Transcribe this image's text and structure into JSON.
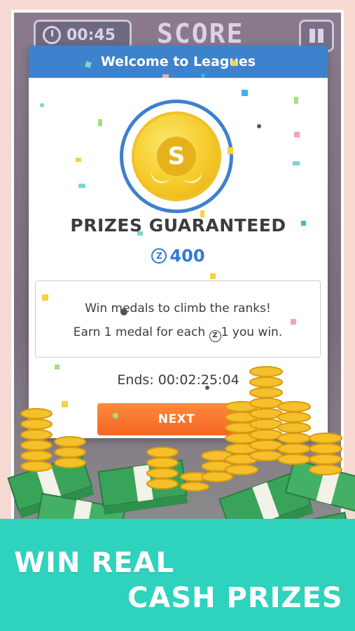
{
  "hud": {
    "timer": "00:45",
    "score_label": "SCORE"
  },
  "modal": {
    "header": "Welcome to Leagues",
    "coin_symbol": "S",
    "title": "PRIZES GUARANTEED",
    "prize_amount": "400",
    "currency_symbol": "Z",
    "info_line1": "Win medals to climb the ranks!",
    "info_line2_pre": "Earn 1 medal for each",
    "info_line2_post": "1 you win.",
    "ends": "Ends: 00:02:25:04",
    "next_label": "NEXT"
  },
  "promo": {
    "line1": "WIN REAL",
    "line2": "CASH PRIZES"
  },
  "colors": {
    "header_blue": "#3d82cc",
    "prize_blue": "#2f7ad6",
    "button_orange": "#f26622",
    "banner_teal": "#2fd2bd",
    "coin_gold": "#f5cb2b",
    "cash_green": "#3aa35a"
  },
  "icons": {
    "timer": "clock-icon",
    "pause": "pause-icon",
    "coin": "gold-coin-icon",
    "currency": "z-coin-icon"
  }
}
